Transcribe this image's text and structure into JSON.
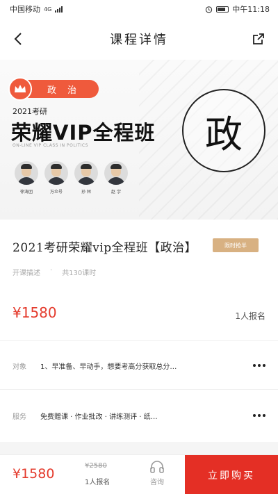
{
  "status_bar": {
    "carrier": "中国移动",
    "network": "4G",
    "time": "中午11:18"
  },
  "nav": {
    "title": "课程详情",
    "back_icon": "chevron-left-icon",
    "share_icon": "share-icon"
  },
  "banner": {
    "subject": "政 治",
    "exam_year": "2021考研",
    "title": "荣耀VIP全程班",
    "subtitle_en": "ON-LINE VIP CLASS IN POLITICS",
    "big_char": "政",
    "teachers": [
      {
        "name": "徐涛团"
      },
      {
        "name": "万众号"
      },
      {
        "name": "孙 林"
      },
      {
        "name": "赵 宇"
      }
    ]
  },
  "course": {
    "title": "2021考研荣耀vip全程班【政治】",
    "badge": "限时抢半",
    "meta_desc": "开课描述",
    "meta_sep": "·",
    "meta_hours": "共130课时",
    "price": "¥1580",
    "enroll_count": "1人报名"
  },
  "rows": {
    "target": {
      "label": "对象",
      "value": "1、早准备、早动手，想要考高分获取总分…"
    },
    "service": {
      "label": "服务",
      "value": "免费赠课  ·  作业批改  ·  讲练测评  ·  纸…"
    }
  },
  "bottom_bar": {
    "price": "¥1580",
    "original_price": "¥2580",
    "enroll": "1人报名",
    "consult_label": "咨询",
    "buy_label": "立即购买"
  },
  "colors": {
    "accent_red": "#e42f25",
    "price_red": "#e43b2d",
    "pill_orange": "#ef5a3c",
    "badge_gold": "#d8b182"
  }
}
